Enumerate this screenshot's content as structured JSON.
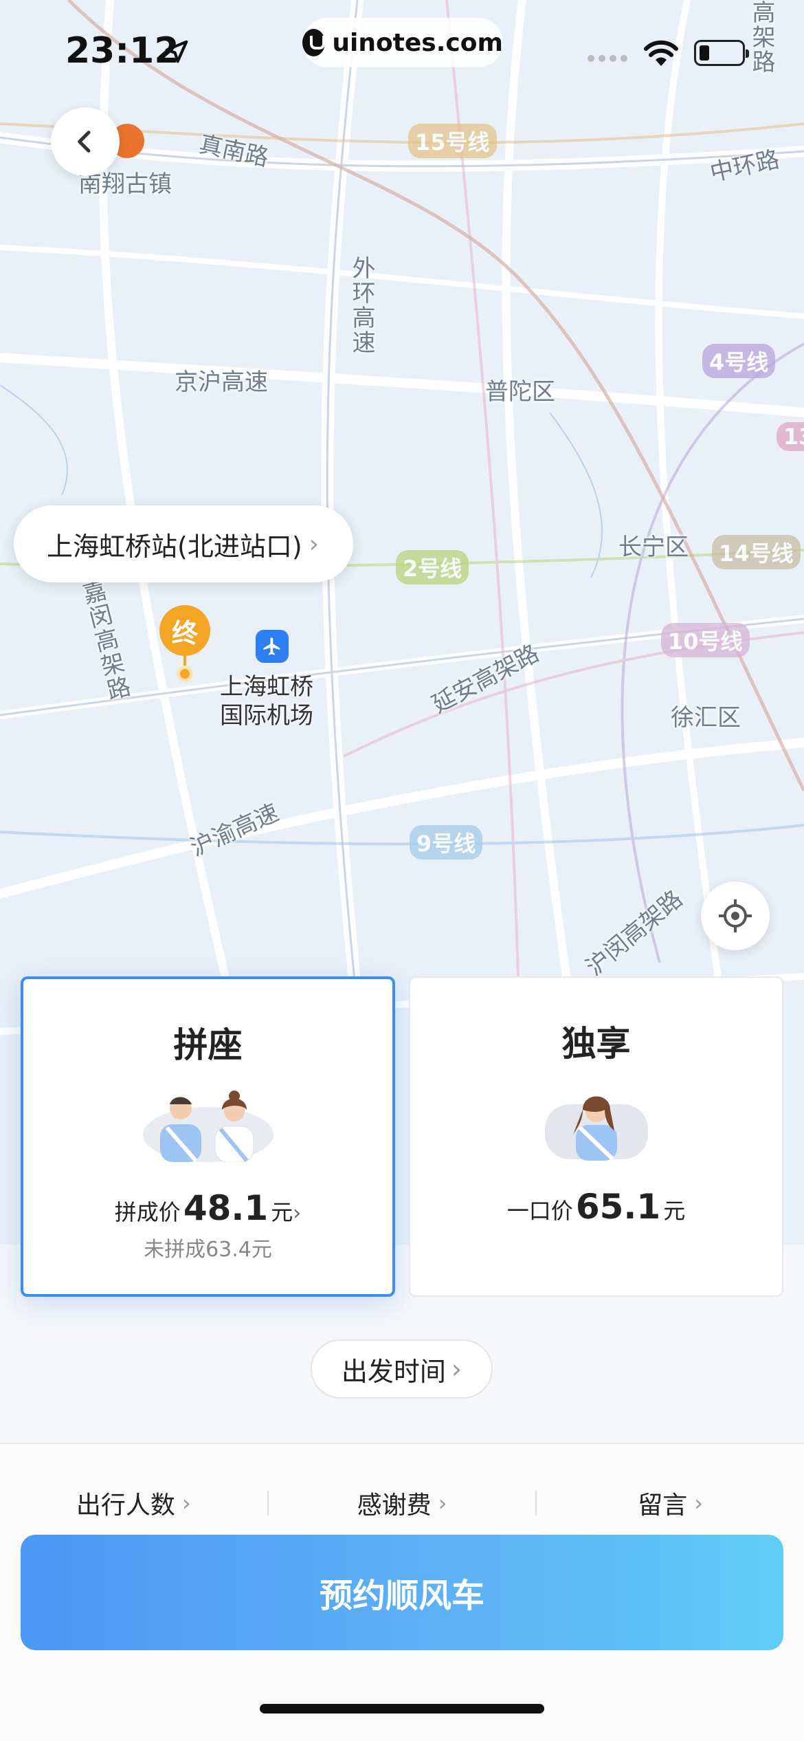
{
  "status_bar": {
    "time": "23:12",
    "url": "uinotes.com"
  },
  "map": {
    "labels": {
      "nanxiang": "南翔古镇",
      "zhennan": "真南路",
      "waihuan": "外环高速",
      "jinghu": "京沪高速",
      "putuo": "普陀区",
      "zhonghuan": "中环路",
      "changning": "长宁区",
      "yanan": "延安高架路",
      "xuhui": "徐汇区",
      "huyu": "沪渝高速",
      "jiamin": "嘉闵高架路",
      "humin": "沪闵高架路",
      "gaojia": "高架路"
    },
    "metro_lines": {
      "line15": "15号线",
      "line4": "4号线",
      "line2": "2号线",
      "line14": "14号线",
      "line10": "10号线",
      "line9": "9号线",
      "line13": "13"
    },
    "destination": "上海虹桥站(北进站口)",
    "end_marker": "终",
    "airport_line1": "上海虹桥",
    "airport_line2": "国际机场",
    "colors": {
      "pin": "#f5a524",
      "airport": "#2f7ff0"
    }
  },
  "cards": {
    "carpool": {
      "title": "拼座",
      "price_prefix": "拼成价",
      "price": "48.1",
      "unit": "元",
      "sub_price": "未拼成63.4元"
    },
    "exclusive": {
      "title": "独享",
      "price_prefix": "一口价",
      "price": "65.1",
      "unit": "元"
    }
  },
  "depart_time": "出发时间",
  "options": {
    "passengers": "出行人数",
    "tip": "感谢费",
    "message": "留言"
  },
  "cta": "预约顺风车",
  "icons": [
    "back-icon",
    "location-arrow-icon",
    "wifi-icon",
    "battery-icon",
    "airport-icon",
    "temple-icon",
    "locate-icon",
    "chevron-right-icon"
  ],
  "accent_color": "#3d8ef2"
}
